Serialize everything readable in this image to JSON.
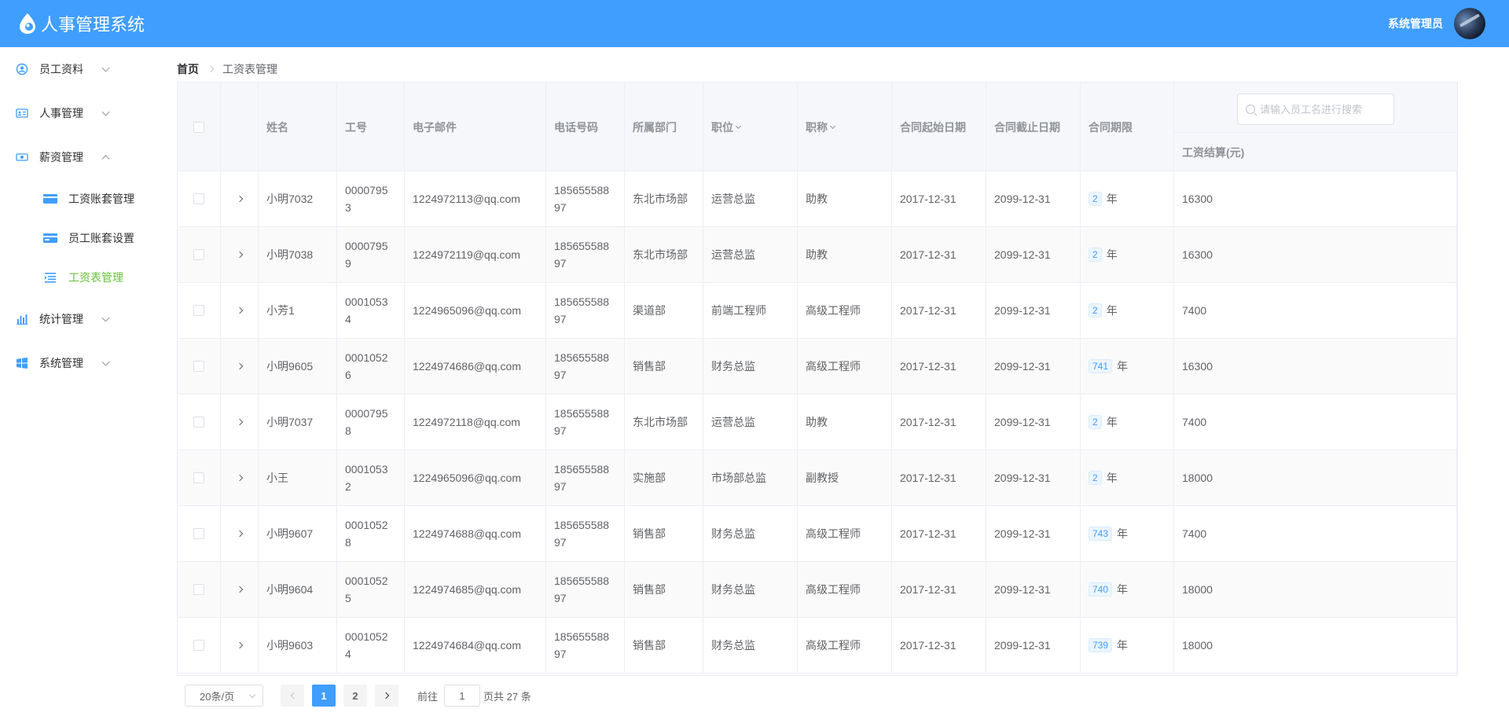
{
  "header": {
    "title": "人事管理系统",
    "user_name": "系统管理员"
  },
  "sidebar": {
    "items": [
      {
        "label": "员工资料",
        "icon": "user-circle-icon",
        "expanded": false
      },
      {
        "label": "人事管理",
        "icon": "id-card-icon",
        "expanded": false
      },
      {
        "label": "薪资管理",
        "icon": "money-icon",
        "expanded": true
      },
      {
        "label": "统计管理",
        "icon": "bar-chart-icon",
        "expanded": false
      },
      {
        "label": "系统管理",
        "icon": "windows-icon",
        "expanded": false
      }
    ],
    "sub_items": [
      {
        "label": "工资账套管理",
        "active": false
      },
      {
        "label": "员工账套设置",
        "active": false
      },
      {
        "label": "工资表管理",
        "active": true
      }
    ]
  },
  "breadcrumb": {
    "home": "首页",
    "current": "工资表管理"
  },
  "table": {
    "columns": {
      "name": "姓名",
      "work_id": "工号",
      "email": "电子邮件",
      "phone": "电话号码",
      "department": "所属部门",
      "position": "职位",
      "title": "职称",
      "begin_date": "合同起始日期",
      "end_date": "合同截止日期",
      "term": "合同期限",
      "salary": "工资结算(元)"
    },
    "search_placeholder": "请输入员工名进行搜索",
    "term_unit": "年",
    "rows": [
      {
        "name": "小明7032",
        "work_id_1": "0000795",
        "work_id_2": "3",
        "email": "1224972113@qq.com",
        "phone_1": "185655588",
        "phone_2": "97",
        "department": "东北市场部",
        "position": "运营总监",
        "title": "助教",
        "begin_date": "2017-12-31",
        "end_date": "2099-12-31",
        "term": "2",
        "salary": "16300"
      },
      {
        "name": "小明7038",
        "work_id_1": "0000795",
        "work_id_2": "9",
        "email": "1224972119@qq.com",
        "phone_1": "185655588",
        "phone_2": "97",
        "department": "东北市场部",
        "position": "运营总监",
        "title": "助教",
        "begin_date": "2017-12-31",
        "end_date": "2099-12-31",
        "term": "2",
        "salary": "16300"
      },
      {
        "name": "小芳1",
        "work_id_1": "0001053",
        "work_id_2": "4",
        "email": "1224965096@qq.com",
        "phone_1": "185655588",
        "phone_2": "97",
        "department": "渠道部",
        "position": "前端工程师",
        "title": "高级工程师",
        "begin_date": "2017-12-31",
        "end_date": "2099-12-31",
        "term": "2",
        "salary": "7400"
      },
      {
        "name": "小明9605",
        "work_id_1": "0001052",
        "work_id_2": "6",
        "email": "1224974686@qq.com",
        "phone_1": "185655588",
        "phone_2": "97",
        "department": "销售部",
        "position": "财务总监",
        "title": "高级工程师",
        "begin_date": "2017-12-31",
        "end_date": "2099-12-31",
        "term": "741",
        "salary": "16300"
      },
      {
        "name": "小明7037",
        "work_id_1": "0000795",
        "work_id_2": "8",
        "email": "1224972118@qq.com",
        "phone_1": "185655588",
        "phone_2": "97",
        "department": "东北市场部",
        "position": "运营总监",
        "title": "助教",
        "begin_date": "2017-12-31",
        "end_date": "2099-12-31",
        "term": "2",
        "salary": "7400"
      },
      {
        "name": "小王",
        "work_id_1": "0001053",
        "work_id_2": "2",
        "email": "1224965096@qq.com",
        "phone_1": "185655588",
        "phone_2": "97",
        "department": "实施部",
        "position": "市场部总监",
        "title": "副教授",
        "begin_date": "2017-12-31",
        "end_date": "2099-12-31",
        "term": "2",
        "salary": "18000"
      },
      {
        "name": "小明9607",
        "work_id_1": "0001052",
        "work_id_2": "8",
        "email": "1224974688@qq.com",
        "phone_1": "185655588",
        "phone_2": "97",
        "department": "销售部",
        "position": "财务总监",
        "title": "高级工程师",
        "begin_date": "2017-12-31",
        "end_date": "2099-12-31",
        "term": "743",
        "salary": "7400"
      },
      {
        "name": "小明9604",
        "work_id_1": "0001052",
        "work_id_2": "5",
        "email": "1224974685@qq.com",
        "phone_1": "185655588",
        "phone_2": "97",
        "department": "销售部",
        "position": "财务总监",
        "title": "高级工程师",
        "begin_date": "2017-12-31",
        "end_date": "2099-12-31",
        "term": "740",
        "salary": "18000"
      },
      {
        "name": "小明9603",
        "work_id_1": "0001052",
        "work_id_2": "4",
        "email": "1224974684@qq.com",
        "phone_1": "185655588",
        "phone_2": "97",
        "department": "销售部",
        "position": "财务总监",
        "title": "高级工程师",
        "begin_date": "2017-12-31",
        "end_date": "2099-12-31",
        "term": "739",
        "salary": "18000"
      }
    ]
  },
  "pagination": {
    "page_size": "20条/页",
    "pages": [
      "1",
      "2"
    ],
    "current_page": "1",
    "goto_label": "前往",
    "goto_value": "1",
    "total_text": "页共 27 条"
  },
  "colors": {
    "header_bg": "#409eff",
    "active_menu": "#67c23a",
    "tag": "#409eff"
  }
}
